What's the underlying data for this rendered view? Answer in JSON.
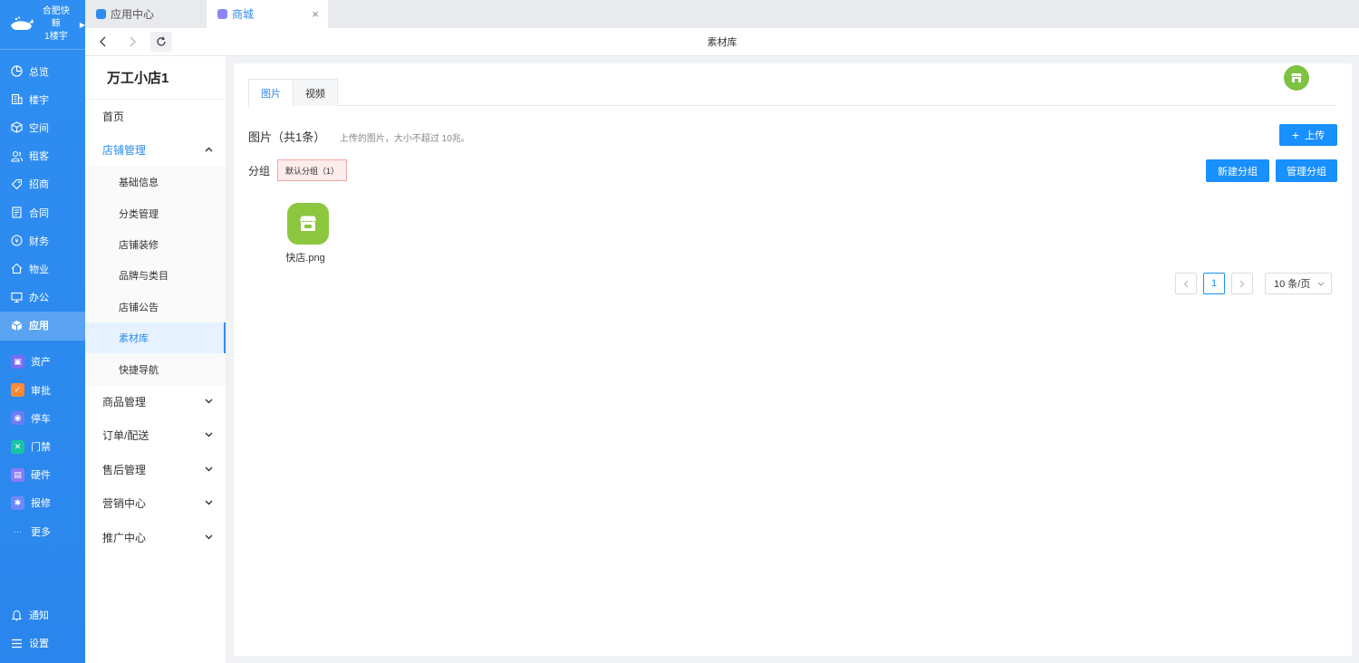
{
  "brand": {
    "name": "合肥快鲸",
    "building": "1楼宇"
  },
  "sidebar": {
    "items": [
      {
        "label": "总览",
        "icon": "dashboard-icon"
      },
      {
        "label": "楼宇",
        "icon": "building-icon"
      },
      {
        "label": "空间",
        "icon": "cube-icon"
      },
      {
        "label": "租客",
        "icon": "users-icon"
      },
      {
        "label": "招商",
        "icon": "tag-icon"
      },
      {
        "label": "合同",
        "icon": "document-icon"
      },
      {
        "label": "财务",
        "icon": "coin-icon"
      },
      {
        "label": "物业",
        "icon": "home-icon"
      },
      {
        "label": "办公",
        "icon": "monitor-icon"
      },
      {
        "label": "应用",
        "icon": "app-cube-icon"
      }
    ],
    "apps": [
      {
        "label": "资产",
        "icon": "asset-icon",
        "color": "#7b6cf6"
      },
      {
        "label": "审批",
        "icon": "approve-icon",
        "color": "#ff8a34"
      },
      {
        "label": "停车",
        "icon": "parking-icon",
        "color": "#6d7cf5"
      },
      {
        "label": "门禁",
        "icon": "access-icon",
        "color": "#19c4a4"
      },
      {
        "label": "硬件",
        "icon": "hardware-icon",
        "color": "#8a7cf8"
      },
      {
        "label": "报修",
        "icon": "repair-icon",
        "color": "#6e88f7"
      }
    ],
    "more": "更多",
    "bottom": [
      {
        "label": "通知",
        "icon": "bell-icon"
      },
      {
        "label": "设置",
        "icon": "menu-icon"
      }
    ]
  },
  "tabs": [
    {
      "label": "应用中心",
      "color": "#2d8cf0"
    },
    {
      "label": "商城",
      "color": "#8b86f5",
      "close": "×"
    }
  ],
  "addressbar": {
    "title": "素材库"
  },
  "submenu": {
    "shop_name": "万工小店1",
    "home": "首页",
    "store_mgmt": "店铺管理",
    "store_children": [
      "基础信息",
      "分类管理",
      "店铺装修",
      "品牌与类目",
      "店铺公告",
      "素材库",
      "快捷导航"
    ],
    "groups": [
      "商品管理",
      "订单/配送",
      "售后管理",
      "营销中心",
      "推广中心"
    ]
  },
  "content": {
    "tabs": [
      "图片",
      "视频"
    ],
    "title": "图片（共1条）",
    "hint": "上传的图片，大小不超过 10兆。",
    "upload": "上传",
    "group_label": "分组",
    "group_tag": "默认分组（1）",
    "new_group": "新建分组",
    "manage_group": "管理分组",
    "file_name": "快店.png",
    "page": "1",
    "page_size": "10 条/页"
  }
}
